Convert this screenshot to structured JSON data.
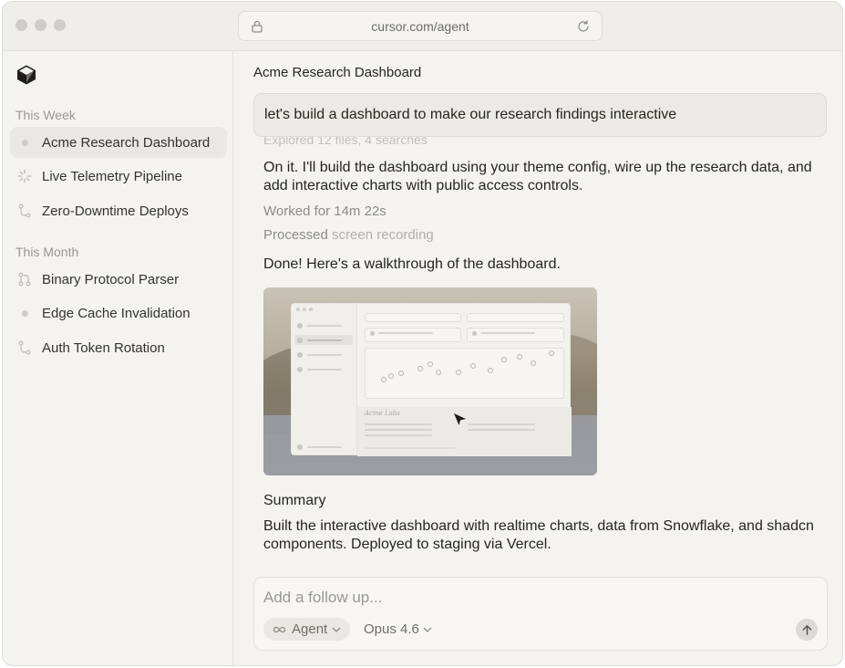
{
  "browser": {
    "url": "cursor.com/agent"
  },
  "sidebar": {
    "sections": [
      {
        "label": "This Week",
        "items": [
          {
            "label": "Acme Research Dashboard",
            "icon": "dot-icon",
            "active": true
          },
          {
            "label": "Live Telemetry Pipeline",
            "icon": "spinner-icon"
          },
          {
            "label": "Zero-Downtime Deploys",
            "icon": "branch-icon"
          }
        ]
      },
      {
        "label": "This Month",
        "items": [
          {
            "label": "Binary Protocol Parser",
            "icon": "pull-request-icon"
          },
          {
            "label": "Edge Cache Invalidation",
            "icon": "dot-icon"
          },
          {
            "label": "Auth Token Rotation",
            "icon": "branch-icon"
          }
        ]
      }
    ]
  },
  "chat": {
    "title": "Acme Research Dashboard",
    "user_message": "let's build a dashboard to make our research findings interactive",
    "explored": "Explored 12 files, 4 searches",
    "reply_intro": "On it. I'll build the dashboard using your theme config, wire up the research data, and add interactive charts with public access controls.",
    "worked_for": "Worked for 14m 22s",
    "processed_label": "Processed",
    "processed_item": "screen recording",
    "done_text": "Done! Here's a walkthrough of the dashboard.",
    "video_caption_label": "Acme Labs",
    "summary_heading": "Summary",
    "summary_text": "Built the interactive dashboard with realtime charts, data from Snowflake, and shadcn components. Deployed to staging via Vercel."
  },
  "composer": {
    "placeholder": "Add a follow up...",
    "mode_label": "Agent",
    "model_label": "Opus 4.6"
  }
}
